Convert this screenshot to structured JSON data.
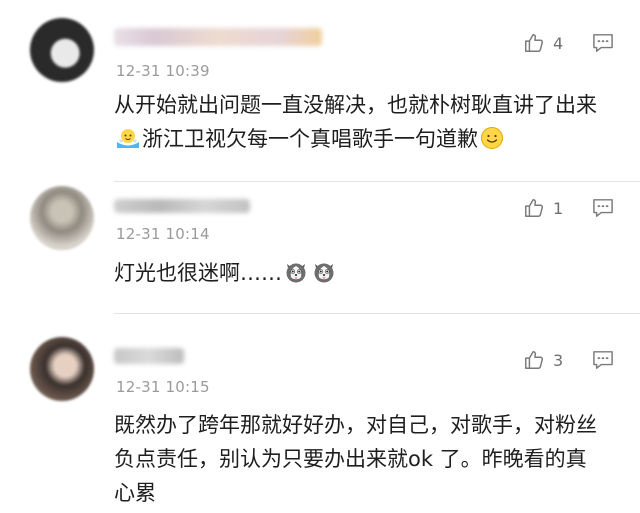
{
  "comments": [
    {
      "time": "12-31 10:39",
      "likes": "4",
      "text_before": "从开始就出问题一直没解决，也就朴树耿直讲了出来",
      "text_middle": "浙江卫视欠每一个真唱歌手一句道歉",
      "emojis": [
        "bathing-face-emoji",
        "smile-face-emoji"
      ]
    },
    {
      "time": "12-31 10:14",
      "likes": "1",
      "text": "灯光也很迷啊……",
      "emojis": [
        "husky-face-emoji",
        "husky-face-emoji"
      ]
    },
    {
      "time": "12-31 10:15",
      "likes": "3",
      "text": "既然办了跨年那就好好办，对自己，对歌手，对粉丝负点责任，别认为只要办出来就ok 了。昨晚看的真心累"
    }
  ],
  "colors": {
    "timestamp": "#9a9a9a",
    "icon": "#7a7a7a",
    "divider": "#e3e3e3"
  }
}
